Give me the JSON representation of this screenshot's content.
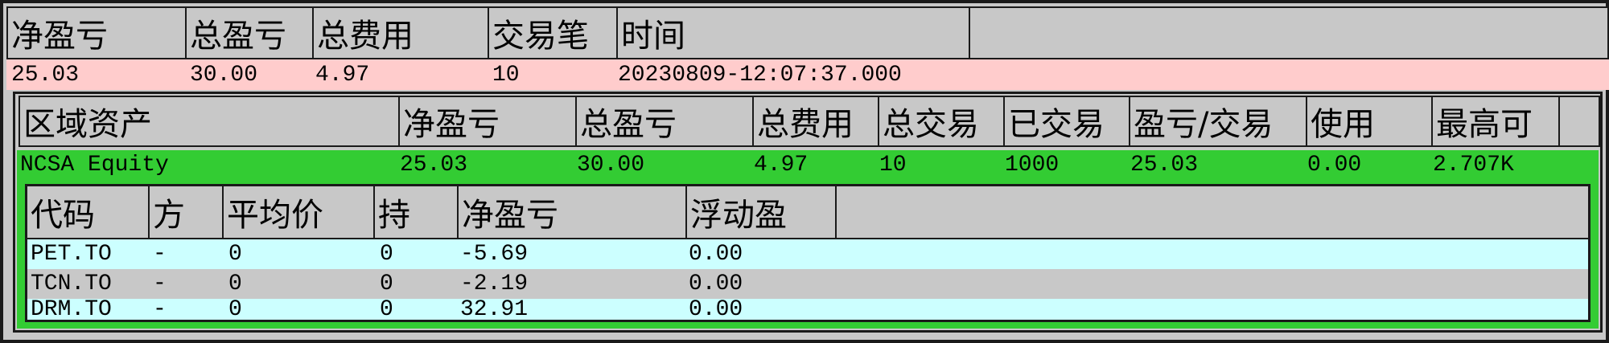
{
  "top": {
    "headers": [
      "净盈亏",
      "总盈亏",
      "总费用",
      "交易笔",
      "时间",
      ""
    ],
    "row": [
      "25.03",
      "30.00",
      "4.97",
      "10",
      "20230809-12:07:37.000"
    ]
  },
  "region": {
    "headers": [
      "区域资产",
      "净盈亏",
      "总盈亏",
      "总费用",
      "总交易",
      "已交易",
      "盈亏/交易",
      "使用",
      "最高可",
      ""
    ],
    "row": [
      "NCSA Equity",
      "25.03",
      "30.00",
      "4.97",
      "10",
      "1000",
      "25.03",
      "0.00",
      "2.707K"
    ]
  },
  "positions": {
    "headers": [
      "代码",
      "方",
      "平均价",
      "持",
      "净盈亏",
      "浮动盈",
      ""
    ],
    "rows": [
      [
        "PET.TO",
        "-",
        "0",
        "0",
        "-5.69",
        "0.00"
      ],
      [
        "TCN.TO",
        "-",
        "0",
        "0",
        "-2.19",
        "0.00"
      ],
      [
        "DRM.TO",
        "-",
        "0",
        "0",
        "32.91",
        "0.00"
      ]
    ]
  },
  "colors": {
    "header_bg": "#c8c8c8",
    "top_row_bg": "#ffcccc",
    "region_row_bg": "#33cc33",
    "position_row_cyan": "#ccffff",
    "position_row_gray": "#c8c8c8",
    "border": "#1a1a1a"
  }
}
